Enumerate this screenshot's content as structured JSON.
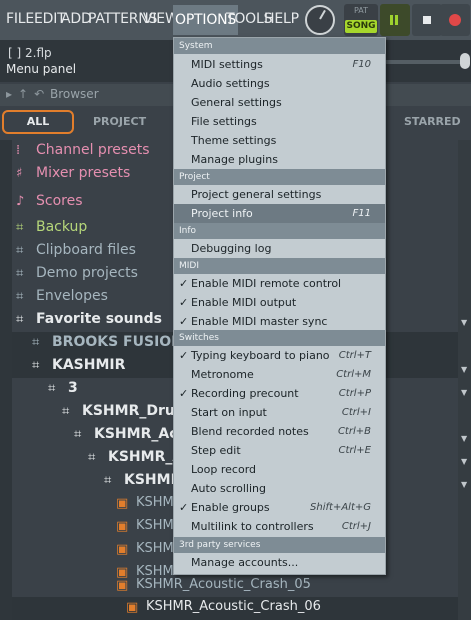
{
  "menubar": {
    "items": [
      "FILE",
      "EDIT",
      "ADD",
      "PATTERNS",
      "VIEW",
      "OPTIONS",
      "TOOLS",
      "HELP"
    ],
    "active": "OPTIONS"
  },
  "transport": {
    "pat_label": "PAT",
    "song_label": "SONG"
  },
  "hint": {
    "project_name": "[ ] 2.flp",
    "text": "Menu panel"
  },
  "browser": {
    "label": "Browser",
    "tabs": [
      "ALL",
      "PROJECT",
      "STARRED"
    ],
    "items": [
      {
        "label": "Channel presets",
        "color": "#e58fb0",
        "icon": "channel-presets-icon"
      },
      {
        "label": "Mixer presets",
        "color": "#e58fb0",
        "icon": "mixer-presets-icon"
      },
      {
        "label": "Scores",
        "color": "#e58fb0",
        "icon": "scores-icon"
      },
      {
        "label": "Backup",
        "color": "#b6d77a",
        "icon": "folder-icon"
      },
      {
        "label": "Clipboard files",
        "color": "#a6b6bf",
        "icon": "folder-icon"
      },
      {
        "label": "Demo projects",
        "color": "#a6b6bf",
        "icon": "folder-icon"
      },
      {
        "label": "Envelopes",
        "color": "#a6b6bf",
        "icon": "folder-icon"
      },
      {
        "label": "Favorite sounds",
        "color": "#e7eaec",
        "icon": "folder-open-icon"
      },
      {
        "label": "BROOKS FUSION",
        "color": "#a6b6bf",
        "icon": "folder-icon"
      },
      {
        "label": "KASHMIR",
        "color": "#e7eaec",
        "icon": "folder-open-icon"
      },
      {
        "label": "3",
        "color": "#e7eaec",
        "icon": "folder-open-icon"
      },
      {
        "label": "KSHMR_Drums",
        "color": "#e7eaec",
        "icon": "folder-open-icon"
      },
      {
        "label": "KSHMR_Acou",
        "color": "#e7eaec",
        "icon": "folder-open-icon"
      },
      {
        "label": "KSHMR_Ac",
        "color": "#e7eaec",
        "icon": "folder-open-icon"
      },
      {
        "label": "KSHMR_",
        "color": "#e7eaec",
        "icon": "folder-open-icon"
      },
      {
        "label": "KSHMR",
        "color": "#a6b6bf",
        "icon": "audio-file-icon"
      },
      {
        "label": "KSHMR",
        "color": "#a6b6bf",
        "icon": "audio-file-icon"
      },
      {
        "label": "KSHMR",
        "color": "#a6b6bf",
        "icon": "audio-file-icon"
      },
      {
        "label": "KSHMR",
        "color": "#a6b6bf",
        "icon": "audio-file-icon"
      },
      {
        "label": "KSHMR_Acoustic_Crash_05",
        "color": "#a6b6bf",
        "icon": "audio-file-icon"
      },
      {
        "label": "KSHMR_Acoustic_Crash_06",
        "color": "#e7eaec",
        "icon": "audio-file-icon"
      }
    ]
  },
  "options_menu": {
    "sections": {
      "system": "System",
      "project": "Project",
      "info": "Info",
      "midi": "MIDI",
      "switches": "Switches",
      "third_party": "3rd party services"
    },
    "system": [
      {
        "label": "MIDI settings",
        "shortcut": "F10"
      },
      {
        "label": "Audio settings",
        "shortcut": ""
      },
      {
        "label": "General settings",
        "shortcut": ""
      },
      {
        "label": "File settings",
        "shortcut": ""
      },
      {
        "label": "Theme settings",
        "shortcut": ""
      },
      {
        "label": "Manage plugins",
        "shortcut": ""
      }
    ],
    "project": [
      {
        "label": "Project general settings",
        "shortcut": ""
      },
      {
        "label": "Project info",
        "shortcut": "F11"
      }
    ],
    "info": [
      {
        "label": "Debugging log",
        "shortcut": ""
      }
    ],
    "midi": [
      {
        "label": "Enable MIDI remote control",
        "checked": true
      },
      {
        "label": "Enable MIDI output",
        "checked": true
      },
      {
        "label": "Enable MIDI master sync",
        "checked": true
      }
    ],
    "switches": [
      {
        "label": "Typing keyboard to piano",
        "shortcut": "Ctrl+T",
        "checked": true
      },
      {
        "label": "Metronome",
        "shortcut": "Ctrl+M",
        "checked": false
      },
      {
        "label": "Recording precount",
        "shortcut": "Ctrl+P",
        "checked": true
      },
      {
        "label": "Start on input",
        "shortcut": "Ctrl+I",
        "checked": false
      },
      {
        "label": "Blend recorded notes",
        "shortcut": "Ctrl+B",
        "checked": false
      },
      {
        "label": "Step edit",
        "shortcut": "Ctrl+E",
        "checked": false
      },
      {
        "label": "Loop record",
        "shortcut": "",
        "checked": false
      },
      {
        "label": "Auto scrolling",
        "shortcut": "",
        "checked": false
      },
      {
        "label": "Enable groups",
        "shortcut": "Shift+Alt+G",
        "checked": true
      },
      {
        "label": "Multilink to controllers",
        "shortcut": "Ctrl+J",
        "checked": false
      }
    ],
    "third_party": [
      {
        "label": "Manage accounts...",
        "shortcut": ""
      }
    ]
  },
  "colors": {
    "accent": "#e27e2c",
    "song_active": "#a6d62c",
    "menu_bg": "#c3ccd1",
    "menu_section": "#7e8c95",
    "menu_highlight": "#6d7a83"
  }
}
